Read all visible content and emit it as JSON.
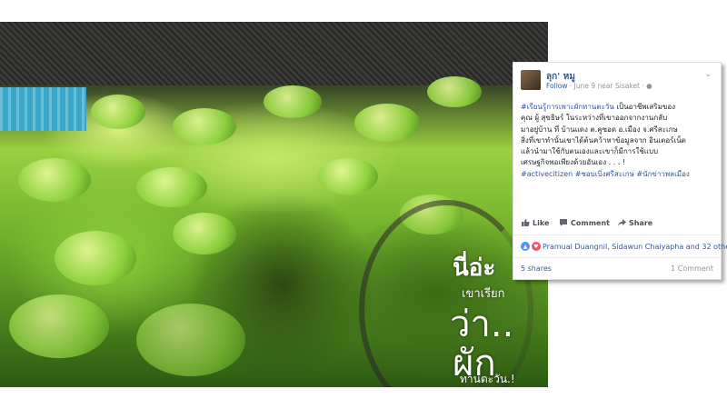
{
  "post": {
    "author": "ลุก' หมู",
    "follow_label": "Follow",
    "meta_rest": " · June 9 near Sisaket · ",
    "body_lines": [
      {
        "hash": "#เรียนรู้การเพาะผักทานตะวัน",
        "text": " เป็นอาชีพเสริมของ"
      },
      {
        "hash": "",
        "text": "คุณ ผู้ สุขธิษร์ ในระหว่างที่เขาออกจากงานกลับ"
      },
      {
        "hash": "",
        "text": "มาอยู่บ้าน ที่ บ้านแดง ต.คูซอด อ.เมือง จ.ศรีสะเกษ"
      },
      {
        "hash": "",
        "text": "สิ่งที่เขาทำนั้นเขาได้ต้นคว้าหาข้อมูลจาก อินเตอร์เน็ต"
      },
      {
        "hash": "",
        "text": "แล้วนำมาใช้กับตนเองและเขาก็มีการใช้แบบ"
      },
      {
        "hash": "",
        "text": "เศรษฐกิจพอเพียงด้วยอันเอง . . . !"
      }
    ],
    "hashtags_line": "#activecitizen #ชอบเบิ่งศรีสะเกษ #นักข่าวพลเมือง",
    "actions": {
      "like": "Like",
      "comment": "Comment",
      "share": "Share"
    },
    "reactions_text": "Pramual Duangnil, Sidawun Chaiyapha and 32 others",
    "shares": "5 shares",
    "comments": "1 Comment"
  },
  "photo_overlay": {
    "line1": "นี่อ่ะ",
    "line2": "เขาเรียก",
    "line3": "ว่า..",
    "line4": "ผัก",
    "line5": "ทานตะวัน.!"
  },
  "colors": {
    "link": "#365899",
    "like_blue": "#5890ff",
    "love_red": "#f25268"
  }
}
